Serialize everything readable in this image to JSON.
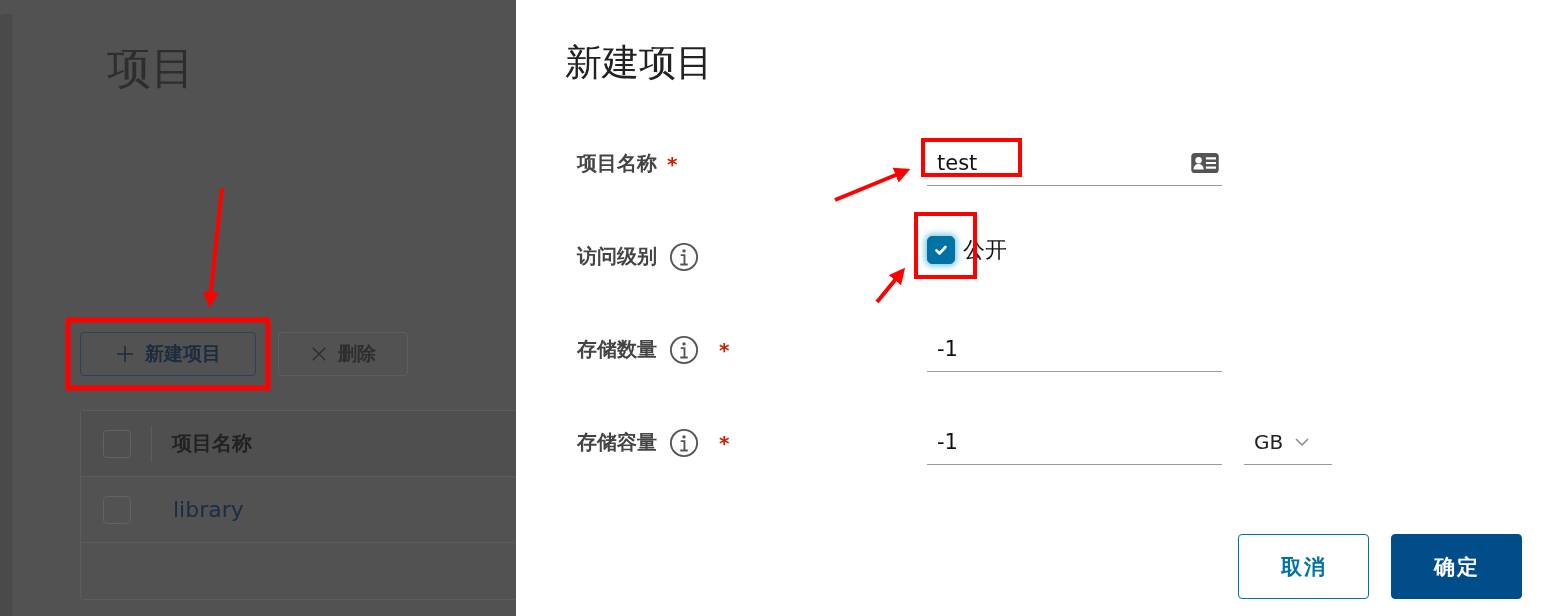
{
  "page": {
    "title": "项目",
    "toolbar": [
      {
        "kind": "add",
        "label": "新建项目",
        "disabled": false
      },
      {
        "kind": "delete",
        "label": "删除",
        "disabled": true
      }
    ],
    "table": {
      "columns": [
        "项目名称"
      ],
      "header_checked": false,
      "rows": [
        {
          "name": "library",
          "checked": false
        }
      ]
    }
  },
  "dialog": {
    "title": "新建项目",
    "fields": [
      {
        "kind": "text",
        "label": "项目名称",
        "info": false,
        "required_mark": "*",
        "value": "test"
      },
      {
        "kind": "checkbox",
        "label": "访问级别",
        "info": true,
        "checked": true,
        "option": "公开"
      },
      {
        "kind": "number",
        "label": "存储数量",
        "info": true,
        "required_mark": "*",
        "value": "-1"
      },
      {
        "kind": "unit",
        "label": "存储容量",
        "info": true,
        "required_mark": "*",
        "value": "-1",
        "unit": "GB"
      }
    ],
    "buttons": [
      {
        "kind": "secondary",
        "label": "取消"
      },
      {
        "kind": "primary",
        "label": "确定"
      }
    ]
  }
}
